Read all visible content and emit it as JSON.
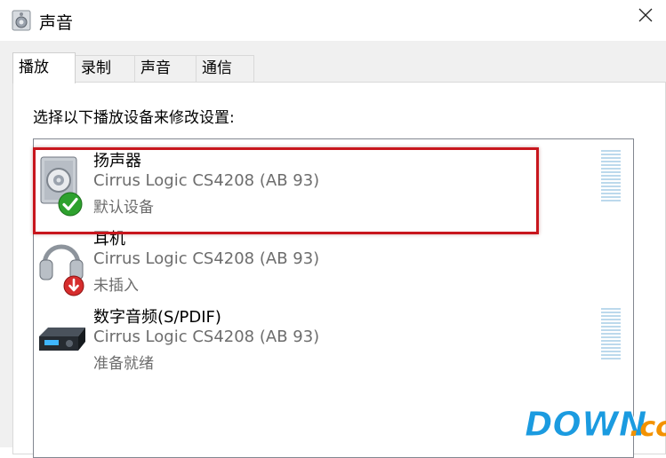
{
  "window": {
    "title": "声音"
  },
  "tabs": [
    {
      "label": "播放",
      "active": true
    },
    {
      "label": "录制",
      "active": false
    },
    {
      "label": "声音",
      "active": false
    },
    {
      "label": "通信",
      "active": false
    }
  ],
  "instruction": "选择以下播放设备来修改设置:",
  "devices": [
    {
      "name": "扬声器",
      "driver": "Cirrus Logic CS4208 (AB 93)",
      "status": "默认设备",
      "icon": "speaker-icon",
      "badge": "green-check-icon",
      "selected": true
    },
    {
      "name": "耳机",
      "driver": "Cirrus Logic CS4208 (AB 93)",
      "status": "未插入",
      "icon": "headphones-icon",
      "badge": "red-down-arrow-icon",
      "selected": false
    },
    {
      "name": "数字音频(S/PDIF)",
      "driver": "Cirrus Logic CS4208 (AB 93)",
      "status": "准备就绪",
      "icon": "digital-audio-device-icon",
      "badge": null,
      "selected": false
    }
  ],
  "watermark": {
    "text": "DOWN.cc"
  },
  "colors": {
    "highlight": "#c8161d",
    "status_text": "#6d6d6d",
    "level_meter": "#bcd9ec",
    "check_green": "#2ea12e"
  }
}
